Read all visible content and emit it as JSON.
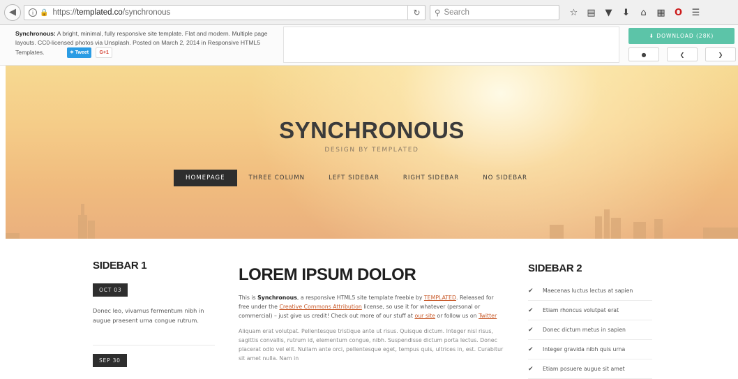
{
  "browser": {
    "url_prefix": "https://",
    "url_domain": "templated.co",
    "url_path": "/synchronous",
    "search_placeholder": "Search"
  },
  "templated_bar": {
    "name": "Synchronous:",
    "description": " A bright, minimal, fully responsive site template. Flat and modern. Multiple page layouts. CC0-licensed photos via Unsplash. Posted on March 2, 2014 in Responsive HTML5 Templates.",
    "tweet_label": "Tweet",
    "gplus_label": "G+1",
    "download_label": "DOWNLOAD (28K)"
  },
  "hero": {
    "title": "SYNCHRONOUS",
    "subtitle": "DESIGN BY TEMPLATED",
    "menu": [
      "HOMEPAGE",
      "THREE COLUMN",
      "LEFT SIDEBAR",
      "RIGHT SIDEBAR",
      "NO SIDEBAR"
    ]
  },
  "sidebar1": {
    "heading": "SIDEBAR 1",
    "posts": [
      {
        "date": "OCT 03",
        "text": "Donec leo, vivamus fermentum nibh in augue praesent urna congue rutrum."
      },
      {
        "date": "SEP 30"
      }
    ]
  },
  "main": {
    "heading": "LOREM IPSUM DOLOR",
    "intro": {
      "t1": "This is ",
      "b1": "Synchronous",
      "t2": ", a responsive HTML5 site template freebie by ",
      "l1": "TEMPLATED",
      "t3": ". Released for free under the ",
      "l2": "Creative Commons Attribution",
      "t4": " license, so use it for whatever (personal or commercial) – just give us credit! Check out more of our stuff at ",
      "l3": "our site",
      "t5": " or follow us on ",
      "l4": "Twitter"
    },
    "paragraph2": "Aliquam erat volutpat. Pellentesque tristique ante ut risus. Quisque dictum. Integer nisl risus, sagittis convallis, rutrum id, elementum congue, nibh. Suspendisse dictum porta lectus. Donec placerat odio vel elit. Nullam ante orci, pellentesque eget, tempus quis, ultrices in, est. Curabitur sit amet nulla. Nam in"
  },
  "sidebar2": {
    "heading": "SIDEBAR 2",
    "items": [
      "Maecenas luctus lectus at sapien",
      "Etiam rhoncus volutpat erat",
      "Donec dictum metus in sapien",
      "Integer gravida nibh quis urna",
      "Etiam posuere augue sit amet"
    ]
  },
  "icons": {
    "back": "back-arrow-icon",
    "info": "info-icon",
    "lock": "lock-icon",
    "reload": "reload-icon",
    "search": "search-icon",
    "bookmark": "star-icon",
    "reading_list": "clipboard-icon",
    "pocket": "pocket-icon",
    "downloads": "download-arrow-icon",
    "home": "home-icon",
    "menu": "hamburger-icon"
  },
  "colors": {
    "accent": "#5cc4a8",
    "link": "#c85a2a",
    "nav_active": "#2e2e2e",
    "tweet": "#2b9ce4"
  }
}
